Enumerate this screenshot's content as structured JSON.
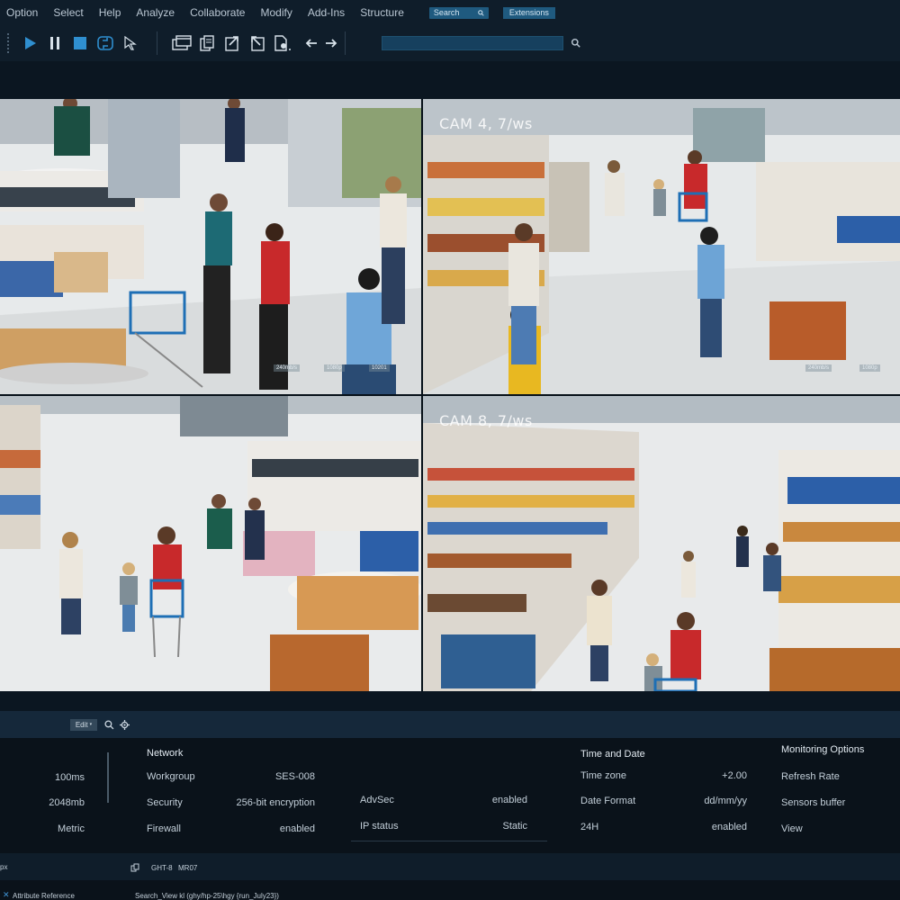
{
  "menu": {
    "items": [
      "Option",
      "Select",
      "Help",
      "Analyze",
      "Collaborate",
      "Modify",
      "Add-Ins",
      "Structure"
    ],
    "search_label": "Search",
    "extensions_label": "Extensions"
  },
  "toolbar": {
    "icons": [
      "play-icon",
      "pause-icon",
      "stop-icon",
      "rotate-icon",
      "cursor-icon",
      "windows-icon",
      "copy-icon",
      "export-icon",
      "import-icon",
      "document-icon",
      "back-arrow-icon",
      "forward-arrow-icon"
    ],
    "search_value": ""
  },
  "feeds": [
    {
      "label": "",
      "chips": [
        "240mb/s",
        "1080p",
        "10201"
      ]
    },
    {
      "label": "CAM 4, 7/ws",
      "chips": [
        "240mb/s",
        "1080p"
      ]
    },
    {
      "label": "",
      "chips": []
    },
    {
      "label": "CAM 8, 7/ws",
      "chips": []
    }
  ],
  "editbar": {
    "edit_label": "Edit"
  },
  "panel": {
    "left": {
      "values": [
        "100ms",
        "2048mb",
        "Metric"
      ]
    },
    "network": {
      "heading": "Network",
      "rows": [
        {
          "label": "Workgroup",
          "value": "SES-008"
        },
        {
          "label": "Security",
          "value": "256-bit encryption"
        },
        {
          "label": "Firewall",
          "value": "enabled"
        }
      ]
    },
    "adv": {
      "rows": [
        {
          "label": "AdvSec",
          "value": "enabled"
        },
        {
          "label": "IP status",
          "value": "Static"
        }
      ]
    },
    "time": {
      "heading": "Time and Date",
      "rows": [
        {
          "label": "Time zone",
          "value": "+2.00"
        },
        {
          "label": "Date Format",
          "value": "dd/mm/yy"
        },
        {
          "label": "24H",
          "value": "enabled"
        }
      ]
    },
    "monitoring": {
      "heading": "Monitoring Options",
      "items": [
        "Refresh Rate",
        "Sensors buffer",
        "View"
      ]
    }
  },
  "statusbar": {
    "left": "px",
    "code1": "GHT-8",
    "code2": "MR07"
  },
  "footer": {
    "left": "Attribute Reference",
    "right": "Search_View kl (ghy/hp-25\\hgy {run_July23})"
  },
  "colors": {
    "accent": "#1f5a7f",
    "background": "#0b1621",
    "panel": "#0a121a"
  }
}
